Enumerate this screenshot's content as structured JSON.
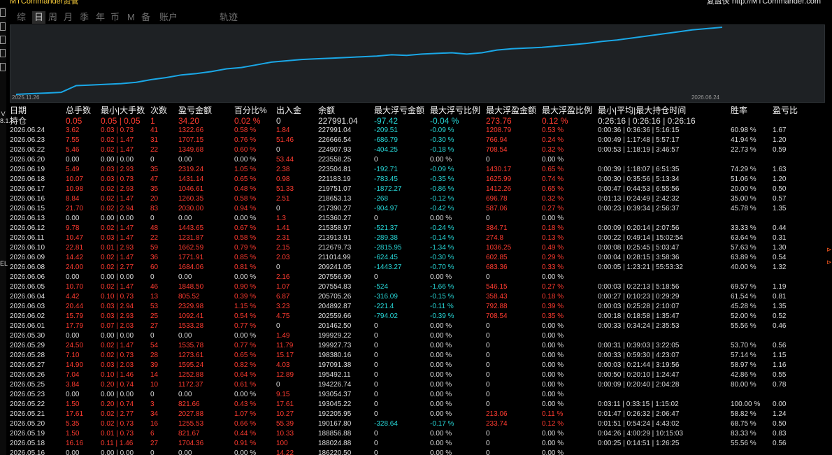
{
  "app_title": "MTCommander资管",
  "brand": "复盘侠 http://MTCommander.com",
  "colors": {
    "background": "#000000",
    "chart_bg": "#1e2124",
    "line": "#1aa7e6",
    "negative": "#27d7d7",
    "positive": "#ff3b30",
    "header_text": "#f0f0f0"
  },
  "left_toolbar": {
    "icons": [
      "move-icon",
      "file-icon",
      "window-icon",
      "grid-icon",
      "copy-icon"
    ],
    "texts": [
      "V 8.1.8",
      "EL"
    ]
  },
  "tabs": [
    "综",
    "日",
    "周",
    "月",
    "季",
    "年",
    "币",
    "M",
    "备",
    "账户",
    "轨迹"
  ],
  "active_tab": "日",
  "chart": {
    "start_date": "2025.11.26",
    "end_date": "2026.06.24",
    "x_range": [
      "2025.11.26",
      "2026.06.24"
    ],
    "note": "y axis unlabeled; line shows balance trajectory (approx. 0-1 relative scale)",
    "y_relative": [
      0.0,
      0.01,
      0.02,
      0.03,
      0.13,
      0.14,
      0.15,
      0.16,
      0.18,
      0.22,
      0.25,
      0.29,
      0.31,
      0.34,
      0.38,
      0.4,
      0.44,
      0.48,
      0.5,
      0.52,
      0.53,
      0.54,
      0.55,
      0.56,
      0.57,
      0.59,
      0.58,
      0.6,
      0.61,
      0.62,
      0.6,
      0.62,
      0.66,
      0.68,
      0.69,
      0.7,
      0.72,
      0.74,
      0.76,
      0.79,
      0.81,
      0.84,
      0.87,
      0.9,
      0.93,
      0.96,
      0.98,
      1.0
    ]
  },
  "chart_data": {
    "type": "line",
    "title": "",
    "xlabel": "",
    "ylabel": "",
    "x_range": [
      "2025.11.26",
      "2026.06.24"
    ],
    "series": [
      {
        "values": [
          0.0,
          0.01,
          0.02,
          0.03,
          0.13,
          0.14,
          0.15,
          0.16,
          0.18,
          0.22,
          0.25,
          0.29,
          0.31,
          0.34,
          0.38,
          0.4,
          0.44,
          0.48,
          0.5,
          0.52,
          0.53,
          0.54,
          0.55,
          0.56,
          0.57,
          0.59,
          0.58,
          0.6,
          0.61,
          0.62,
          0.6,
          0.62,
          0.66,
          0.68,
          0.69,
          0.7,
          0.72,
          0.74,
          0.76,
          0.79,
          0.81,
          0.84,
          0.87,
          0.9,
          0.93,
          0.96,
          0.98,
          1.0
        ]
      }
    ],
    "grid": false
  },
  "table": {
    "headers": [
      "日期",
      "总手数",
      "最小|大手数",
      "次数",
      "盈亏金额",
      "百分比%",
      "出入金",
      "余额",
      "最大浮亏金额",
      "最大浮亏比例",
      "最大浮盈金额",
      "最大浮盈比例",
      "最小|平均|最大持仓时间",
      "胜率",
      "盈亏比"
    ],
    "holding": [
      "持仓",
      "0.05",
      "0.05 | 0.05",
      "1",
      "34.20",
      "0.02 %",
      "0",
      "227991.04",
      "-97.42",
      "-0.04 %",
      "273.76",
      "0.12 %",
      "0:26:16 | 0:26:16 | 0:26:16",
      "",
      ""
    ],
    "rows": [
      [
        "2026.06.24",
        "3.62",
        "0.03 | 0.73",
        "41",
        "1322.66",
        "0.58 %",
        "1.84",
        "227991.04",
        "-209.51",
        "-0.09 %",
        "1208.79",
        "0.53 %",
        "0:00:36 | 0:36:36 | 5:16:15",
        "60.98 %",
        "1.67"
      ],
      [
        "2026.06.23",
        "7.55",
        "0.02 | 1.47",
        "31",
        "1707.15",
        "0.76 %",
        "51.46",
        "226666.54",
        "-686.79",
        "-0.30 %",
        "766.94",
        "0.24 %",
        "0:00:49 | 1:17:48 | 5:57:17",
        "41.94 %",
        "1.20"
      ],
      [
        "2026.06.22",
        "5.46",
        "0.02 | 1.47",
        "22",
        "1349.68",
        "0.60 %",
        "0",
        "224907.93",
        "-404.25",
        "-0.18 %",
        "708.54",
        "0.32 %",
        "0:00:53 | 1:18:19 | 3:46:57",
        "22.73 %",
        "0.59"
      ],
      [
        "2026.06.20",
        "0.00",
        "0.00 | 0.00",
        "0",
        "0.00",
        "0.00 %",
        "53.44",
        "223558.25",
        "0",
        "0.00 %",
        "0",
        "0.00 %",
        "",
        "",
        ""
      ],
      [
        "2026.06.19",
        "5.49",
        "0.03 | 2.93",
        "35",
        "2319.24",
        "1.05 %",
        "2.38",
        "223504.81",
        "-192.71",
        "-0.09 %",
        "1430.17",
        "0.65 %",
        "0:00:39 | 1:18:07 | 6:51:35",
        "74.29 %",
        "1.63"
      ],
      [
        "2026.06.18",
        "10.07",
        "0.03 | 0.73",
        "47",
        "1431.14",
        "0.65 %",
        "0.98",
        "221183.19",
        "-783.45",
        "-0.35 %",
        "1625.99",
        "0.74 %",
        "0:00:30 | 0:35:56 | 5:13:34",
        "51.06 %",
        "1.20"
      ],
      [
        "2026.06.17",
        "10.98",
        "0.02 | 2.93",
        "35",
        "1046.61",
        "0.48 %",
        "51.33",
        "219751.07",
        "-1872.27",
        "-0.86 %",
        "1412.26",
        "0.65 %",
        "0:00:47 | 0:44:53 | 6:55:56",
        "20.00 %",
        "0.50"
      ],
      [
        "2026.06.16",
        "8.84",
        "0.02 | 1.47",
        "20",
        "1260.35",
        "0.58 %",
        "2.51",
        "218653.13",
        "-268",
        "-0.12 %",
        "696.78",
        "0.32 %",
        "0:01:13 | 0:24:49 | 2:42:32",
        "35.00 %",
        "0.57"
      ],
      [
        "2026.06.15",
        "21.70",
        "0.02 | 2.94",
        "83",
        "2030.00",
        "0.94 %",
        "0",
        "217390.27",
        "-904.97",
        "-0.42 %",
        "587.06",
        "0.27 %",
        "0:00:23 | 0:39:34 | 2:56:37",
        "45.78 %",
        "1.35"
      ],
      [
        "2026.06.13",
        "0.00",
        "0.00 | 0.00",
        "0",
        "0.00",
        "0.00 %",
        "1.3",
        "215360.27",
        "0",
        "0.00 %",
        "0",
        "0.00 %",
        "",
        "",
        ""
      ],
      [
        "2026.06.12",
        "9.78",
        "0.02 | 1.47",
        "48",
        "1443.65",
        "0.67 %",
        "1.41",
        "215358.97",
        "-521.37",
        "-0.24 %",
        "384.71",
        "0.18 %",
        "0:00:09 | 0:20:14 | 2:07:56",
        "33.33 %",
        "0.44"
      ],
      [
        "2026.06.11",
        "10.47",
        "0.03 | 1.47",
        "22",
        "1231.87",
        "0.58 %",
        "2.31",
        "213913.91",
        "-289.38",
        "-0.14 %",
        "274.8",
        "0.13 %",
        "0:00:22 | 0:49:14 | 15:02:54",
        "63.64 %",
        "0.31"
      ],
      [
        "2026.06.10",
        "22.81",
        "0.01 | 2.93",
        "59",
        "1662.59",
        "0.79 %",
        "2.15",
        "212679.73",
        "-2815.95",
        "-1.34 %",
        "1036.25",
        "0.49 %",
        "0:00:08 | 0:25:45 | 5:03:47",
        "57.63 %",
        "1.30"
      ],
      [
        "2026.06.09",
        "14.42",
        "0.02 | 1.47",
        "36",
        "1771.91",
        "0.85 %",
        "2.03",
        "211014.99",
        "-624.45",
        "-0.30 %",
        "602.85",
        "0.29 %",
        "0:00:04 | 0:28:15 | 3:58:36",
        "63.89 %",
        "0.54"
      ],
      [
        "2026.06.08",
        "24.00",
        "0.02 | 2.77",
        "60",
        "1684.06",
        "0.81 %",
        "0",
        "209241.05",
        "-1443.27",
        "-0.70 %",
        "683.36",
        "0.33 %",
        "0:00:05 | 1:23:21 | 55:53:32",
        "40.00 %",
        "1.32"
      ],
      [
        "2026.06.06",
        "0.00",
        "0.00 | 0.00",
        "0",
        "0.00",
        "0.00 %",
        "2.16",
        "207556.99",
        "0",
        "0.00 %",
        "0",
        "0.00 %",
        "",
        "",
        ""
      ],
      [
        "2026.06.05",
        "10.70",
        "0.02 | 1.47",
        "46",
        "1848.50",
        "0.90 %",
        "1.07",
        "207554.83",
        "-524",
        "-1.66 %",
        "546.15",
        "0.27 %",
        "0:00:03 | 0:22:13 | 5:18:56",
        "69.57 %",
        "1.19"
      ],
      [
        "2026.06.04",
        "4.42",
        "0.10 | 0.73",
        "13",
        "805.52",
        "0.39 %",
        "6.87",
        "205705.26",
        "-316.09",
        "-0.15 %",
        "358.43",
        "0.18 %",
        "0:00:27 | 0:10:23 | 0:29:29",
        "61.54 %",
        "0.81"
      ],
      [
        "2026.06.03",
        "20.44",
        "0.03 | 2.94",
        "53",
        "2329.98",
        "1.15 %",
        "3.23",
        "204892.87",
        "-221.4",
        "-0.11 %",
        "792.88",
        "0.39 %",
        "0:00:03 | 0:25:28 | 2:10:07",
        "45.28 %",
        "1.35"
      ],
      [
        "2026.06.02",
        "15.79",
        "0.03 | 2.93",
        "25",
        "1092.41",
        "0.54 %",
        "4.75",
        "202559.66",
        "-794.02",
        "-0.39 %",
        "708.54",
        "0.35 %",
        "0:00:18 | 0:18:58 | 1:35:47",
        "52.00 %",
        "0.52"
      ],
      [
        "2026.06.01",
        "17.79",
        "0.07 | 2.03",
        "27",
        "1533.28",
        "0.77 %",
        "0",
        "201462.50",
        "0",
        "0.00 %",
        "0",
        "0.00 %",
        "0:00:33 | 0:34:24 | 2:35:53",
        "55.56 %",
        "0.46"
      ],
      [
        "2026.05.30",
        "0.00",
        "0.00 | 0.00",
        "0",
        "0.00",
        "0.00 %",
        "1.49",
        "199929.22",
        "0",
        "0.00 %",
        "0",
        "0.00 %",
        "",
        "",
        ""
      ],
      [
        "2026.05.29",
        "24.50",
        "0.02 | 1.47",
        "54",
        "1535.78",
        "0.77 %",
        "11.79",
        "199927.73",
        "0",
        "0.00 %",
        "0",
        "0.00 %",
        "0:00:31 | 0:39:03 | 3:22:05",
        "53.70 %",
        "0.56"
      ],
      [
        "2026.05.28",
        "7.10",
        "0.02 | 0.73",
        "28",
        "1273.61",
        "0.65 %",
        "15.17",
        "198380.16",
        "0",
        "0.00 %",
        "0",
        "0.00 %",
        "0:00:33 | 0:59:30 | 4:23:07",
        "57.14 %",
        "1.15"
      ],
      [
        "2026.05.27",
        "14.90",
        "0.03 | 2.03",
        "39",
        "1595.24",
        "0.82 %",
        "4.03",
        "197091.38",
        "0",
        "0.00 %",
        "0",
        "0.00 %",
        "0:00:03 | 0:21:44 | 3:19:56",
        "58.97 %",
        "1.16"
      ],
      [
        "2026.05.26",
        "7.04",
        "0.10 | 1.46",
        "14",
        "1252.88",
        "0.64 %",
        "12.89",
        "195492.11",
        "0",
        "0.00 %",
        "0",
        "0.00 %",
        "0:00:50 | 0:20:10 | 1:24:47",
        "42.86 %",
        "0.55"
      ],
      [
        "2026.05.25",
        "3.84",
        "0.20 | 0.74",
        "10",
        "1172.37",
        "0.61 %",
        "0",
        "194226.74",
        "0",
        "0.00 %",
        "0",
        "0.00 %",
        "0:00:09 | 0:20:40 | 2:04:28",
        "80.00 %",
        "0.78"
      ],
      [
        "2026.05.23",
        "0.00",
        "0.00 | 0.00",
        "0",
        "0.00",
        "0.00 %",
        "9.15",
        "193054.37",
        "0",
        "0.00 %",
        "0",
        "0.00 %",
        "",
        "",
        ""
      ],
      [
        "2026.05.22",
        "1.50",
        "0.20 | 0.74",
        "3",
        "821.66",
        "0.43 %",
        "17.61",
        "193045.22",
        "0",
        "0.00 %",
        "0",
        "0.00 %",
        "0:03:11 | 0:33:15 | 1:15:02",
        "100.00 %",
        "0.00"
      ],
      [
        "2026.05.21",
        "17.61",
        "0.02 | 2.77",
        "34",
        "2027.88",
        "1.07 %",
        "10.27",
        "192205.95",
        "0",
        "0.00 %",
        "213.06",
        "0.11 %",
        "0:01:47 | 0:26:32 | 2:06:47",
        "58.82 %",
        "1.24"
      ],
      [
        "2026.05.20",
        "5.35",
        "0.02 | 0.73",
        "16",
        "1255.53",
        "0.66 %",
        "55.39",
        "190167.80",
        "-328.64",
        "-0.17 %",
        "233.74",
        "0.12 %",
        "0:01:51 | 0:54:24 | 4:43:02",
        "68.75 %",
        "0.50"
      ],
      [
        "2026.05.19",
        "1.50",
        "0.01 | 0.73",
        "6",
        "821.67",
        "0.44 %",
        "10.33",
        "188856.88",
        "0",
        "0.00 %",
        "0",
        "0.00 %",
        "0:04:26 | 4:00:29 | 10:15:03",
        "83.33 %",
        "0.83"
      ],
      [
        "2026.05.18",
        "16.16",
        "0.11 | 1.46",
        "27",
        "1704.36",
        "0.91 %",
        "100",
        "188024.88",
        "0",
        "0.00 %",
        "0",
        "0.00 %",
        "0:00:25 | 0:14:51 | 1:26:25",
        "55.56 %",
        "0.56"
      ],
      [
        "2026.05.16",
        "0.00",
        "0.00 | 0.00",
        "0",
        "0.00",
        "0.00 %",
        "14.22",
        "186220.50",
        "0",
        "0.00 %",
        "0",
        "0.00 %",
        "",
        "",
        ""
      ]
    ]
  }
}
